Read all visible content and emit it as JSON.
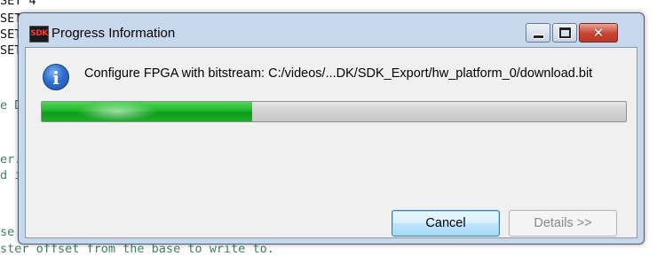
{
  "editor": {
    "lines": [
      {
        "kind": "code",
        "text": "SET 4"
      },
      {
        "kind": "code",
        "text": "SET"
      },
      {
        "kind": "code",
        "text": "SET"
      },
      {
        "kind": "comment",
        "text": "e D"
      },
      {
        "kind": "comment",
        "text": "er."
      },
      {
        "kind": "comment",
        "text": "d i"
      },
      {
        "kind": "comment",
        "text": "se"
      },
      {
        "kind": "comment",
        "text": "ster offset from the base to write to."
      }
    ]
  },
  "dialog": {
    "app_icon_text": "SDK",
    "title": "Progress Information",
    "controls": {
      "minimize": "minimize-icon",
      "maximize": "maximize-icon",
      "close": "close-icon"
    },
    "info_icon": "i",
    "message": "Configure FPGA with bitstream: C:/videos/...DK/SDK_Export/hw_platform_0/download.bit",
    "progress": 0.36,
    "buttons": {
      "cancel": "Cancel",
      "details": "Details >>"
    }
  }
}
